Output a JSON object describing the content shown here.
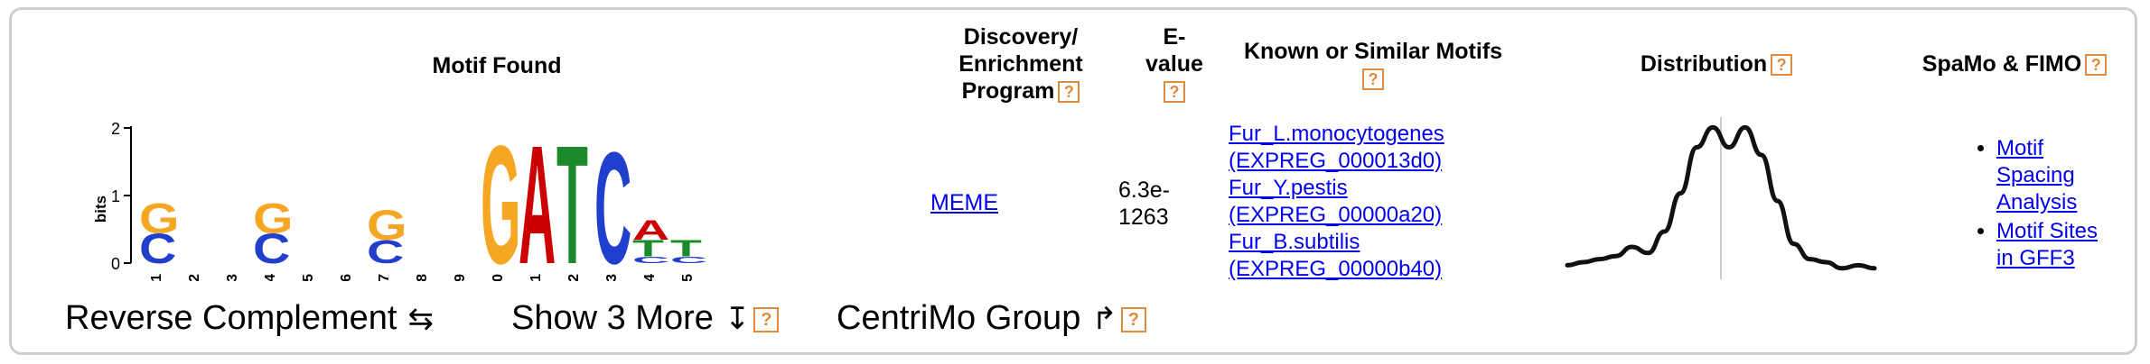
{
  "headers": {
    "motif_found": "Motif Found",
    "program_line1": "Discovery/",
    "program_line2": "Enrichment",
    "program_line3": "Program",
    "evalue_line1": "E-",
    "evalue_line2": "value",
    "known_motifs": "Known or Similar Motifs",
    "distribution": "Distribution",
    "spamo_fimo": "SpaMo & FIMO",
    "help_glyph": "?"
  },
  "logo": {
    "y_axis_label": "bits",
    "y_ticks": [
      "2",
      "1",
      "0"
    ],
    "positions": [
      "1",
      "2",
      "3",
      "4",
      "5",
      "6",
      "7",
      "8",
      "9",
      "10",
      "11",
      "12",
      "13",
      "14",
      "15"
    ],
    "major_letters": [
      {
        "pos": 1,
        "letter": "G",
        "color": "#f5a623",
        "height_bits": 0.45
      },
      {
        "pos": 1,
        "letter": "C",
        "color": "#1f3fcc",
        "height_bits": 0.45
      },
      {
        "pos": 4,
        "letter": "G",
        "color": "#f5a623",
        "height_bits": 0.45
      },
      {
        "pos": 4,
        "letter": "C",
        "color": "#1f3fcc",
        "height_bits": 0.45
      },
      {
        "pos": 7,
        "letter": "G",
        "color": "#f5a623",
        "height_bits": 0.45
      },
      {
        "pos": 7,
        "letter": "C",
        "color": "#1f3fcc",
        "height_bits": 0.35
      },
      {
        "pos": 10,
        "letter": "G",
        "color": "#f5a623",
        "height_bits": 1.8
      },
      {
        "pos": 11,
        "letter": "A",
        "color": "#cc0000",
        "height_bits": 1.8
      },
      {
        "pos": 12,
        "letter": "T",
        "color": "#1a8a2a",
        "height_bits": 1.8
      },
      {
        "pos": 13,
        "letter": "C",
        "color": "#1f3fcc",
        "height_bits": 1.7
      },
      {
        "pos": 14,
        "letter": "A",
        "color": "#cc0000",
        "height_bits": 0.3
      },
      {
        "pos": 14,
        "letter": "T",
        "color": "#1a8a2a",
        "height_bits": 0.25
      },
      {
        "pos": 14,
        "letter": "C",
        "color": "#1f3fcc",
        "height_bits": 0.1
      },
      {
        "pos": 15,
        "letter": "T",
        "color": "#1a8a2a",
        "height_bits": 0.25
      },
      {
        "pos": 15,
        "letter": "C",
        "color": "#1f3fcc",
        "height_bits": 0.1
      }
    ]
  },
  "program": {
    "link_text": "MEME"
  },
  "evalue": {
    "line1": "6.3e-",
    "line2": "1263"
  },
  "known_motifs": [
    {
      "line1": "Fur_L.monocytogenes",
      "line2": "(EXPREG_000013d0)"
    },
    {
      "line1": "Fur_Y.pestis",
      "line2": "(EXPREG_00000a20)"
    },
    {
      "line1": "Fur_B.subtilis",
      "line2": "(EXPREG_00000b40)"
    }
  ],
  "distribution": {
    "description_values": [
      0.08,
      0.1,
      0.12,
      0.14,
      0.2,
      0.16,
      0.3,
      0.55,
      0.85,
      0.98,
      0.85,
      0.98,
      0.8,
      0.5,
      0.22,
      0.12,
      0.1,
      0.06,
      0.08,
      0.06
    ]
  },
  "spamo": {
    "items": [
      {
        "line1": "Motif",
        "line2": "Spacing",
        "line3": "Analysis"
      },
      {
        "line1": "Motif Sites",
        "line2": "in GFF3"
      }
    ]
  },
  "controls": {
    "reverse_complement": "Reverse Complement",
    "reverse_glyph": "⇆",
    "show_more": "Show 3 More",
    "show_more_glyph": "↧",
    "centrimo_group": "CentriMo Group",
    "centrimo_glyph": "↱"
  }
}
